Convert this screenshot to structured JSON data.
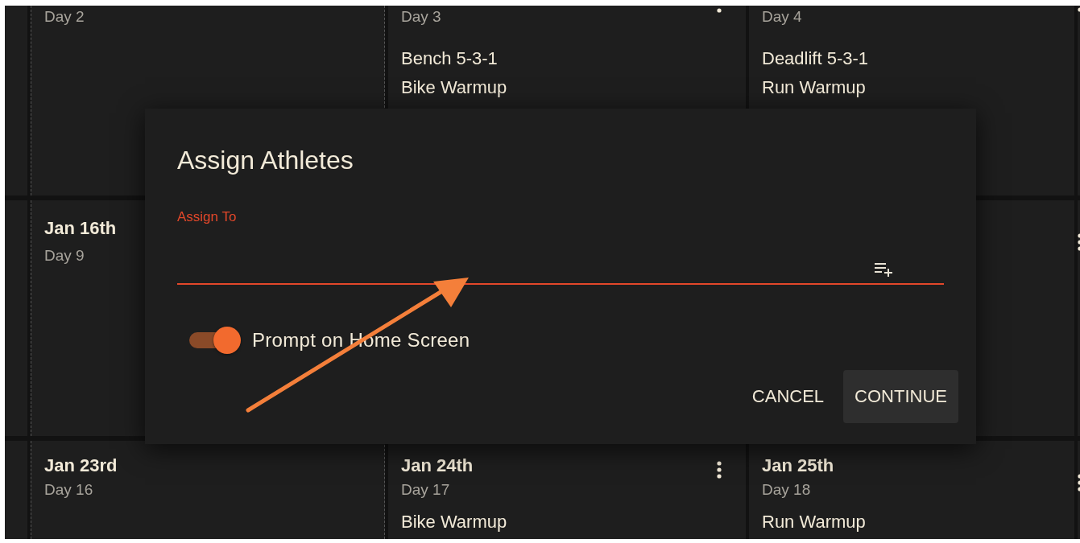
{
  "calendar": {
    "rows": [
      {
        "cells": [
          {
            "day": "Day 2"
          },
          {
            "day": "Day 3",
            "workouts": [
              "Bench 5-3-1",
              "Bike Warmup"
            ]
          },
          {
            "day": "Day 4",
            "workouts": [
              "Deadlift 5-3-1",
              "Run Warmup"
            ]
          }
        ]
      },
      {
        "cells": [
          {
            "date": "Jan 16th",
            "day": "Day 9"
          },
          {},
          {}
        ]
      },
      {
        "cells": [
          {
            "date": "Jan 23rd",
            "day": "Day 16"
          },
          {
            "date": "Jan 24th",
            "day": "Day 17",
            "workouts": [
              "Bike Warmup"
            ]
          },
          {
            "date": "Jan 25th",
            "day": "Day 18",
            "workouts": [
              "Run Warmup"
            ]
          }
        ]
      }
    ]
  },
  "dialog": {
    "title": "Assign Athletes",
    "field": {
      "label": "Assign To",
      "focused": true
    },
    "toggle": {
      "label": "Prompt on Home Screen",
      "on": true
    },
    "buttons": [
      {
        "label": "CANCEL",
        "kind": "text"
      },
      {
        "label": "CONTINUE",
        "kind": "filled"
      }
    ]
  },
  "annotation": {
    "kind": "arrow"
  }
}
